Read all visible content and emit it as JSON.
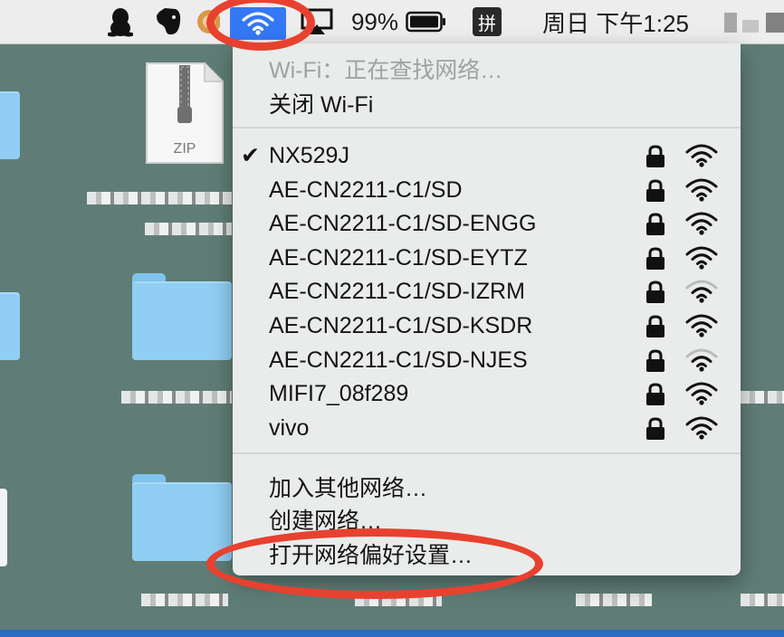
{
  "menubar": {
    "battery_percent": "99%",
    "input_method": "拼",
    "clock": "周日 下午1:25"
  },
  "desktop": {
    "zip_label": "ZIP"
  },
  "wifi_menu": {
    "status": "Wi-Fi：正在查找网络…",
    "toggle": "关闭 Wi-Fi",
    "networks": [
      {
        "name": "NX529J",
        "connected": true,
        "locked": true,
        "signal": "full"
      },
      {
        "name": "AE-CN2211-C1/SD",
        "connected": false,
        "locked": true,
        "signal": "full"
      },
      {
        "name": "AE-CN2211-C1/SD-ENGG",
        "connected": false,
        "locked": true,
        "signal": "full"
      },
      {
        "name": "AE-CN2211-C1/SD-EYTZ",
        "connected": false,
        "locked": true,
        "signal": "full"
      },
      {
        "name": "AE-CN2211-C1/SD-IZRM",
        "connected": false,
        "locked": true,
        "signal": "weak"
      },
      {
        "name": "AE-CN2211-C1/SD-KSDR",
        "connected": false,
        "locked": true,
        "signal": "full"
      },
      {
        "name": "AE-CN2211-C1/SD-NJES",
        "connected": false,
        "locked": true,
        "signal": "weak"
      },
      {
        "name": "MIFI7_08f289",
        "connected": false,
        "locked": true,
        "signal": "full"
      },
      {
        "name": "vivo",
        "connected": false,
        "locked": true,
        "signal": "full"
      }
    ],
    "join_other": "加入其他网络…",
    "create_network": "创建网络…",
    "open_preferences": "打开网络偏好设置…"
  },
  "colors": {
    "accent": "#3478f6",
    "annotation": "#e8412f"
  }
}
